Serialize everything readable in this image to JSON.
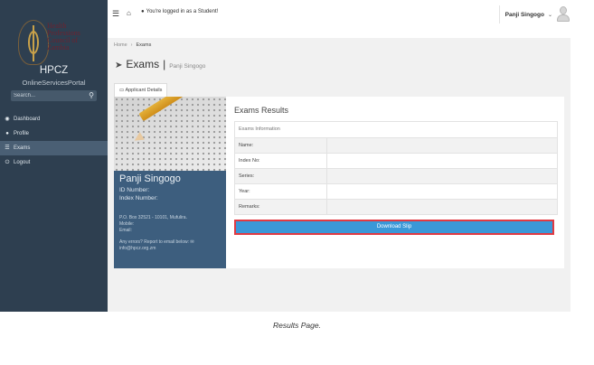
{
  "sidebar": {
    "logo_lines": [
      "Health",
      "Professions",
      "Council of Zambia"
    ],
    "portal_name": "HPCZ",
    "portal_sub": "OnlineServicesPortal",
    "search_placeholder": "Search...",
    "items": [
      {
        "label": "Dashboard",
        "icon": "dashboard-icon"
      },
      {
        "label": "Profile",
        "icon": "user-icon"
      },
      {
        "label": "Exams",
        "icon": "list-icon",
        "active": true
      },
      {
        "label": "Logout",
        "icon": "power-icon"
      }
    ]
  },
  "topbar": {
    "logged_in_text": "You're logged in as a Student!",
    "username": "Panji Singogo",
    "caret": "⌄"
  },
  "breadcrumb": {
    "home": "Home",
    "sep": "›",
    "current": "Exams"
  },
  "page": {
    "title": "Exams",
    "sep": "|",
    "subtitle": "Panji Singogo"
  },
  "tab_label": "Applicant Details",
  "profile": {
    "name": "Panji Singogo",
    "id_label": "ID Number:",
    "index_label": "Index Number:",
    "address": "P.O. Box 32521 - 10101, Mufulira.",
    "mobile_label": "Mobile:",
    "email_label": "Email:",
    "errors_text": "Any errors? Report to email below:",
    "report_email": "info@hpcz.org.zm"
  },
  "results": {
    "title": "Exams Results",
    "header": "Exams Information",
    "rows": [
      {
        "label": "Name:",
        "value": ""
      },
      {
        "label": "Index No:",
        "value": ""
      },
      {
        "label": "Series:",
        "value": ""
      },
      {
        "label": "Year:",
        "value": ""
      },
      {
        "label": "Remarks:",
        "value": ""
      }
    ],
    "download_label": "Download Slip"
  },
  "caption": "Results Page."
}
